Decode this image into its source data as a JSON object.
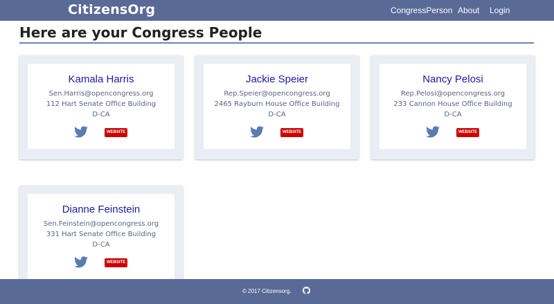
{
  "nav": {
    "brand": "CitizensOrg",
    "links": [
      "CongressPerson",
      "About",
      "Login"
    ]
  },
  "page": {
    "title": "Here are your Congress People"
  },
  "cards": [
    {
      "name": "Kamala Harris",
      "email": "Sen.Harris@opencongress.org",
      "office": "112 Hart Senate Office Building",
      "party": "D-CA",
      "website_label": "WEBSITE",
      "twitter_icon": "twitter-icon"
    },
    {
      "name": "Jackie Speier",
      "email": "Rep.Speier@opencongress.org",
      "office": "2465 Rayburn House Office Building",
      "party": "D-CA",
      "website_label": "WEBSITE",
      "twitter_icon": "twitter-icon"
    },
    {
      "name": "Nancy Pelosi",
      "email": "Rep.Pelosi@opencongress.org",
      "office": "233 Cannon House Office Building",
      "party": "D-CA",
      "website_label": "WEBSITE",
      "twitter_icon": "twitter-icon"
    },
    {
      "name": "Dianne Feinstein",
      "email": "Sen.Feinstein@opencongress.org",
      "office": "331 Hart Senate Office Building",
      "party": "D-CA",
      "website_label": "WEBSITE",
      "twitter_icon": "twitter-icon"
    }
  ],
  "footer": {
    "text": "© 2017 Citizensorg.",
    "icon": "github-icon"
  },
  "colors": {
    "navbar": "#5a6a97",
    "card_background": "#e9eef4",
    "name_text": "#1a1aa6",
    "detail_text": "#5a6382",
    "twitter": "#5b7cae",
    "website_button": "#cc0000"
  }
}
